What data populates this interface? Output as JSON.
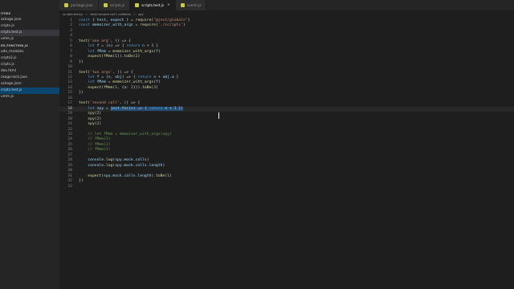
{
  "sidebar": {
    "section1": "ITORS",
    "items1": [
      {
        "label": "ackage.json"
      },
      {
        "label": "cripts.js"
      },
      {
        "label": "cripts.test.js"
      },
      {
        "label": "umm.js"
      }
    ],
    "section2": "ED_FUNCTION_JS",
    "items2": [
      {
        "label": "ode_modules"
      },
      {
        "label": "cripts2.js"
      },
      {
        "label": "cripts.js"
      },
      {
        "label": "dex.html"
      },
      {
        "label": "ckage-lock.json"
      },
      {
        "label": "ackage.json"
      },
      {
        "label": "cripts.test.js"
      },
      {
        "label": "umm.js"
      }
    ]
  },
  "tabs": [
    {
      "label": "package.json",
      "icon": "json-file-icon"
    },
    {
      "label": "scripts.js",
      "icon": "js-file-icon"
    },
    {
      "label": "scripts.test.js",
      "icon": "js-file-icon",
      "active": true
    },
    {
      "label": "summ.js",
      "icon": "js-file-icon"
    }
  ],
  "breadcrumb": {
    "file": "scripts.test.js",
    "sep1": ">",
    "callback": "test('second call') callback",
    "sep2": ">",
    "symbol": "spy"
  },
  "code_lines": [
    {
      "n": "1",
      "t": "const { test, expect } = require(\"@jest/globals\")"
    },
    {
      "n": "2",
      "t": "const memoizer_with_args = require('./scripts')"
    },
    {
      "n": "3",
      "t": ""
    },
    {
      "n": "4",
      "t": ""
    },
    {
      "n": "5",
      "t": "test('one arg', () => {"
    },
    {
      "n": "6",
      "t": "    let f = (n) => { return n + 1 }"
    },
    {
      "n": "7",
      "t": "    let fMem = memoizer_with_args(f)"
    },
    {
      "n": "8",
      "t": "    expect(fMem(1)).toBe(2)"
    },
    {
      "n": "9",
      "t": "})"
    },
    {
      "n": "10",
      "t": ""
    },
    {
      "n": "11",
      "t": "test('two args', () => {"
    },
    {
      "n": "12",
      "t": "    let f = (n, obj) => { return n + obj.a }"
    },
    {
      "n": "13",
      "t": "    let fMem = memoizer_with_args(f)"
    },
    {
      "n": "14",
      "t": "    expect(fMem(1, {a: 2})).toBe(3)"
    },
    {
      "n": "15",
      "t": "})"
    },
    {
      "n": "16",
      "t": ""
    },
    {
      "n": "17",
      "t": "test('second call', () => {"
    },
    {
      "n": "18",
      "t": "    let spy = jest.fn((n) => { return n + 1 })"
    },
    {
      "n": "19",
      "t": "    spy(2)"
    },
    {
      "n": "20",
      "t": "    spy(2)"
    },
    {
      "n": "21",
      "t": "    spy(2)"
    },
    {
      "n": "22",
      "t": ""
    },
    {
      "n": "23",
      "t": "    // let fMem = memoizer_with_args(spy)"
    },
    {
      "n": "24",
      "t": "    // fMem(2)"
    },
    {
      "n": "25",
      "t": "    // fMem(2)"
    },
    {
      "n": "26",
      "t": "    // fMem(2)"
    },
    {
      "n": "27",
      "t": ""
    },
    {
      "n": "28",
      "t": "    console.log(spy.mock.calls)"
    },
    {
      "n": "29",
      "t": "    console.log(spy.mock.calls.length)"
    },
    {
      "n": "30",
      "t": ""
    },
    {
      "n": "31",
      "t": "    expect(spy.mock.calls.length).toBe(1)"
    },
    {
      "n": "32",
      "t": "})"
    },
    {
      "n": "33",
      "t": ""
    }
  ],
  "current_line": "18",
  "selection": {
    "line": "18",
    "text": "jest.fn((n) => { return n + 1 })"
  },
  "colors": {
    "keyword": "#569cd6",
    "function": "#dcdcaa",
    "string": "#ce9178",
    "number": "#b5cea8",
    "variable": "#9cdcfe",
    "comment": "#6a9955",
    "selection": "#264f78",
    "sidebar_active": "#094771"
  }
}
